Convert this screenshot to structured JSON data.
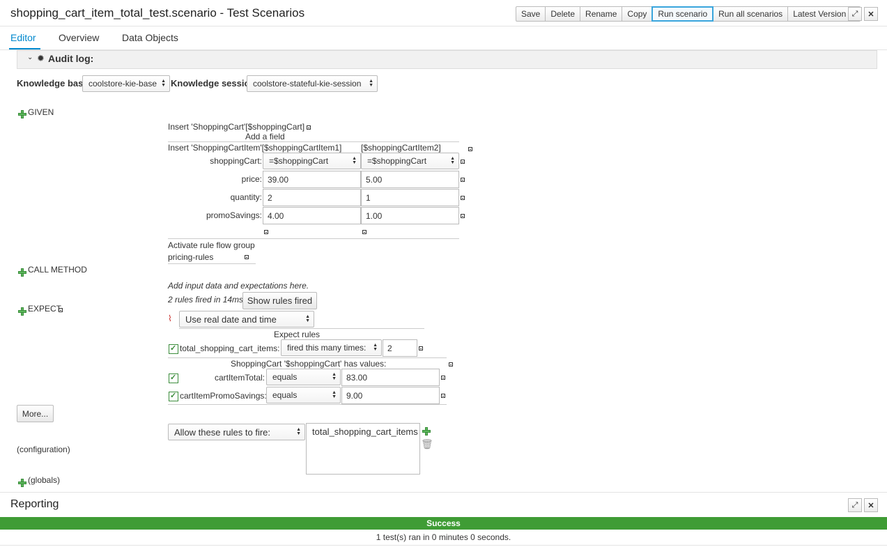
{
  "header": {
    "title": "shopping_cart_item_total_test.scenario - Test Scenarios",
    "buttons": [
      "Save",
      "Delete",
      "Rename",
      "Copy",
      "Run scenario",
      "Run all scenarios"
    ],
    "version_label": "Latest Version",
    "maximize_icon": "expand-icon",
    "close_icon": "close-icon"
  },
  "tabs": [
    "Editor",
    "Overview",
    "Data Objects"
  ],
  "audit_log": {
    "label": "Audit log:"
  },
  "knowledge": {
    "base_label": "Knowledge base",
    "base_value": "coolstore-kie-base",
    "session_label": "Knowledge session",
    "session_value": "coolstore-stateful-kie-session"
  },
  "given": {
    "label": "GIVEN",
    "insert_cart": "Insert 'ShoppingCart'[$shoppingCart]",
    "add_field": "Add a field",
    "insert_items": "Insert 'ShoppingCartItem'[$shoppingCartItem1]",
    "item2_header": "[$shoppingCartItem2]",
    "fields": [
      {
        "name": "shoppingCart:",
        "v1": "=$shoppingCart",
        "v2": "=$shoppingCart"
      },
      {
        "name": "price:",
        "v1": "39.00",
        "v2": "5.00"
      },
      {
        "name": "quantity:",
        "v1": "2",
        "v2": "1"
      },
      {
        "name": "promoSavings:",
        "v1": "4.00",
        "v2": "1.00"
      }
    ],
    "activate_label": "Activate rule flow group",
    "activate_value": "pricing-rules"
  },
  "call_method": {
    "label": "CALL METHOD"
  },
  "expect": {
    "hint": "Add input data and expectations here.",
    "rules_fired_text": "2 rules fired in 14ms.",
    "show_rules_button": "Show rules fired",
    "date_select": "Use real date and time",
    "label": "EXPECT",
    "expect_rules_header": "Expect rules",
    "rule_name": "total_shopping_cart_items:",
    "rule_op": "fired this many times:",
    "rule_count": "2",
    "has_values_header": "ShoppingCart '$shoppingCart' has values:",
    "checks": [
      {
        "name": "cartItemTotal:",
        "op": "equals",
        "value": "83.00"
      },
      {
        "name": "cartItemPromoSavings:",
        "op": "equals",
        "value": "9.00"
      }
    ]
  },
  "more_button": "More...",
  "config": {
    "label": "(configuration)",
    "rules_mode": "Allow these rules to fire:",
    "rules_list": [
      "total_shopping_cart_items"
    ]
  },
  "globals": {
    "label": "(globals)"
  },
  "reporting": {
    "title": "Reporting",
    "status": "Success",
    "summary": "1 test(s) ran in 0 minutes 0 seconds."
  },
  "colors": {
    "accent": "#0088ce",
    "success": "#3f9c35",
    "add": "#5cb85c"
  }
}
